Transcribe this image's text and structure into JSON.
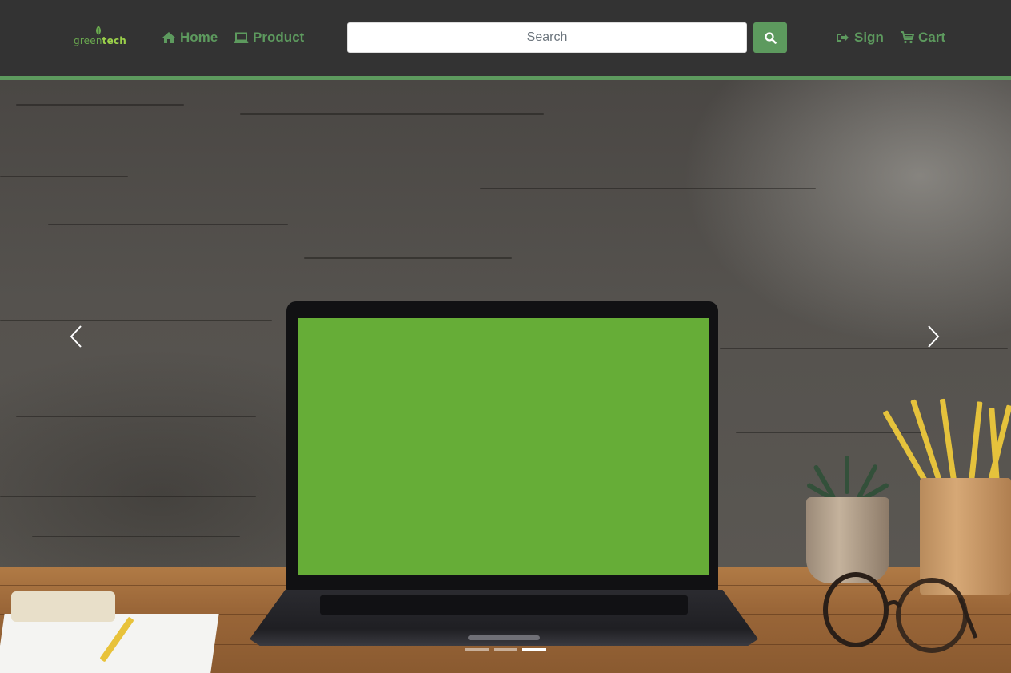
{
  "brand": {
    "logo_text_part1": "green",
    "logo_text_part2": "tech",
    "logo_color": "#6aa84f",
    "logo_accent": "#9bd14a"
  },
  "nav": {
    "home_label": "Home",
    "home_icon": "home-icon",
    "product_label": "Product",
    "product_icon": "laptop-icon",
    "sign_label": "Sign",
    "sign_icon": "sign-in-icon",
    "cart_label": "Cart",
    "cart_icon": "cart-icon"
  },
  "search": {
    "placeholder": "Search",
    "value": "",
    "button_icon": "search-icon"
  },
  "colors": {
    "navbar_bg": "#333333",
    "accent": "#5d9a5e",
    "screen_green": "#66ad37"
  },
  "carousel": {
    "slides": 3,
    "active_index": 2,
    "prev_icon": "chevron-left-icon",
    "next_icon": "chevron-right-icon"
  }
}
